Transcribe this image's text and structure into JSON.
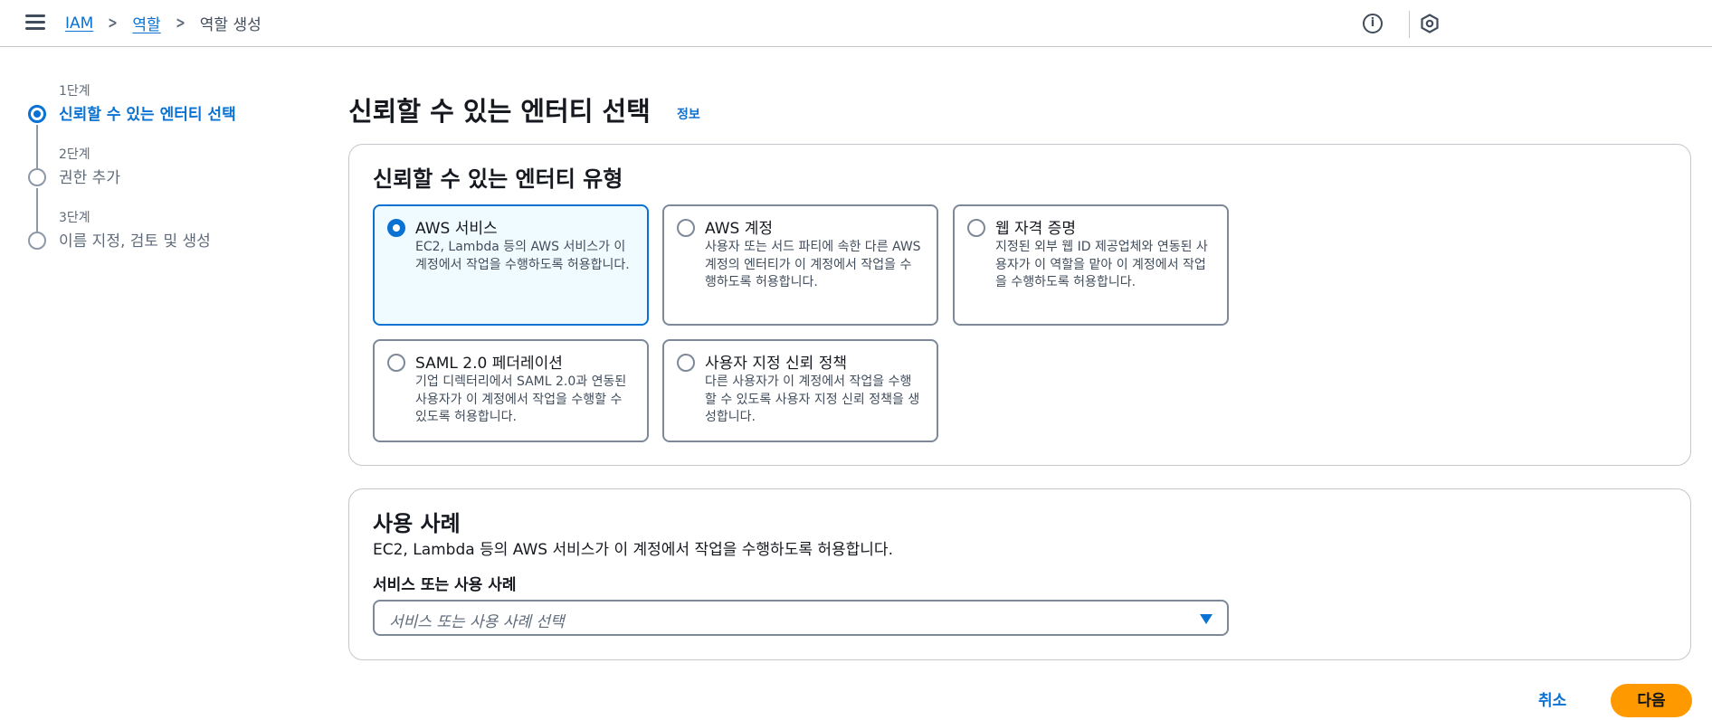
{
  "breadcrumb": {
    "iam": "IAM",
    "roles": "역할",
    "current": "역할 생성"
  },
  "icons": {
    "menu": "hamburger-menu-icon",
    "info": "info-circle-icon",
    "settings": "settings-hexagon-icon",
    "separator": "chevron-right-icon"
  },
  "steps": [
    {
      "number": "1단계",
      "label": "신뢰할 수 있는 엔터티 선택",
      "active": true
    },
    {
      "number": "2단계",
      "label": "권한 추가",
      "active": false
    },
    {
      "number": "3단계",
      "label": "이름 지정, 검토 및 생성",
      "active": false
    }
  ],
  "page": {
    "title": "신뢰할 수 있는 엔터티 선택",
    "info_link": "정보"
  },
  "entity_panel": {
    "title": "신뢰할 수 있는 엔터티 유형",
    "options": [
      {
        "title": "AWS 서비스",
        "description": "EC2, Lambda 등의 AWS 서비스가 이 계정에서 작업을 수행하도록 허용합니다.",
        "selected": true
      },
      {
        "title": "AWS 계정",
        "description": "사용자 또는 서드 파티에 속한 다른 AWS 계정의 엔터티가 이 계정에서 작업을 수행하도록 허용합니다.",
        "selected": false
      },
      {
        "title": "웹 자격 증명",
        "description": "지정된 외부 웹 ID 제공업체와 연동된 사용자가 이 역할을 맡아 이 계정에서 작업을 수행하도록 허용합니다.",
        "selected": false
      },
      {
        "title": "SAML 2.0 페더레이션",
        "description": "기업 디렉터리에서 SAML 2.0과 연동된 사용자가 이 계정에서 작업을 수행할 수 있도록 허용합니다.",
        "selected": false
      },
      {
        "title": "사용자 지정 신뢰 정책",
        "description": "다른 사용자가 이 계정에서 작업을 수행할 수 있도록 사용자 지정 신뢰 정책을 생성합니다.",
        "selected": false
      }
    ]
  },
  "usecase_panel": {
    "title": "사용 사례",
    "description": "EC2, Lambda 등의 AWS 서비스가 이 계정에서 작업을 수행하도록 허용합니다.",
    "field_label": "서비스 또는 사용 사례",
    "select_placeholder": "서비스 또는 사용 사례 선택"
  },
  "footer": {
    "cancel": "취소",
    "next": "다음"
  },
  "colors": {
    "accent": "#0972d3",
    "primary_button": "#ff9900",
    "selected_tile_bg": "#f0fbff"
  }
}
